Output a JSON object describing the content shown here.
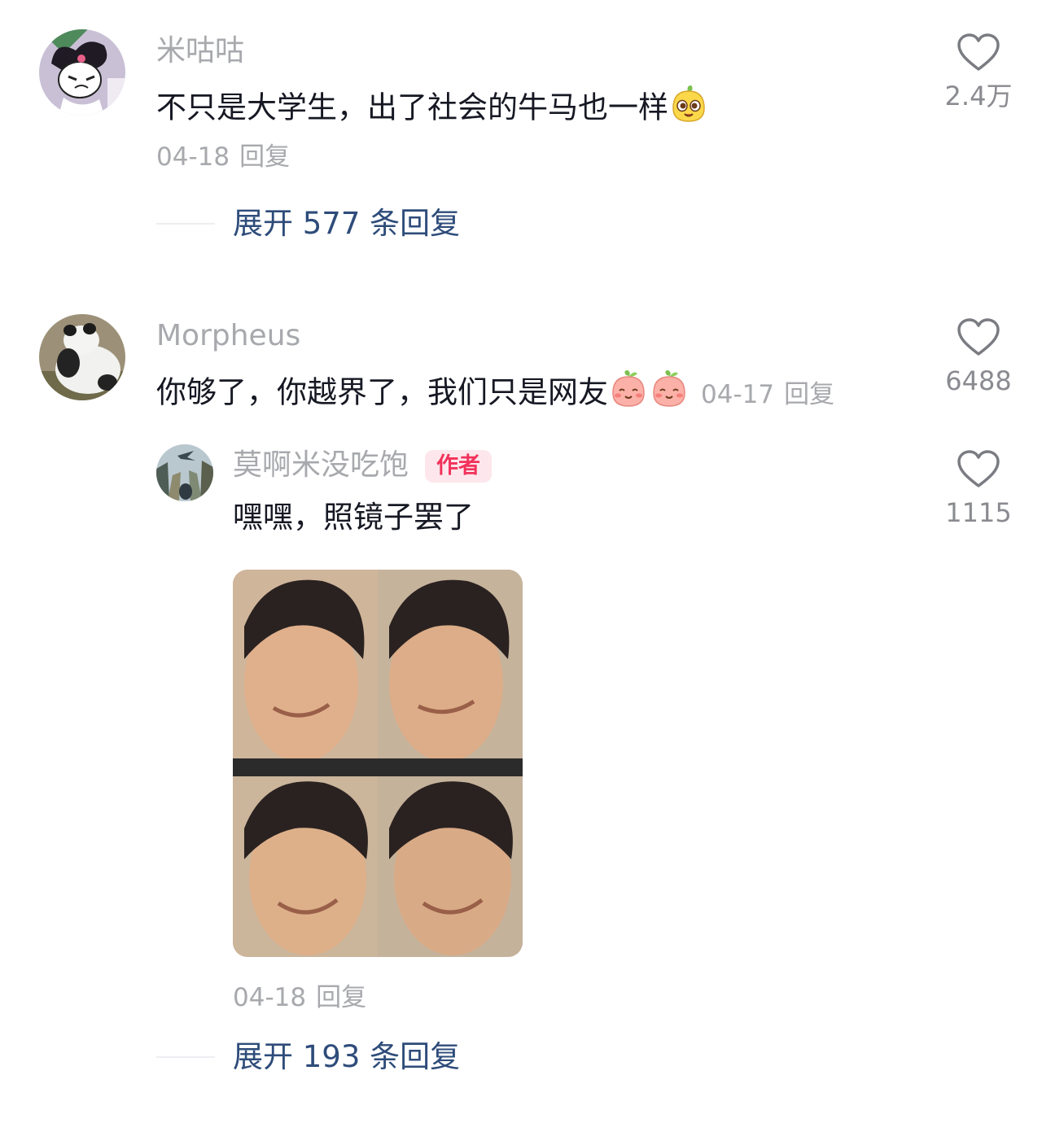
{
  "comments": [
    {
      "username": "米咕咕",
      "text": "不只是大学生，出了社会的牛马也一样",
      "emoji": "mango-face-emoji",
      "date": "04-18",
      "reply_label": "回复",
      "like_count": "2.4万",
      "expand_label": "展开 577 条回复"
    },
    {
      "username": "Morpheus",
      "text": "你够了，你越界了，我们只是网友",
      "emoji": "peach-smile-emoji",
      "date": "04-17",
      "reply_label": "回复",
      "like_count": "6488",
      "reply": {
        "username": "莫啊米没吃饱",
        "badge": "作者",
        "text": "嘿嘿，照镜子罢了",
        "image": "four-panel-face-grid-photo",
        "date": "04-18",
        "reply_label": "回复",
        "like_count": "1115"
      },
      "expand_label": "展开 193 条回复"
    }
  ],
  "colors": {
    "username": "#a7a9ad",
    "text": "#161823",
    "expand": "#2e4c7a",
    "author_badge_bg": "#fde7ec",
    "author_badge_text": "#f2325b"
  }
}
